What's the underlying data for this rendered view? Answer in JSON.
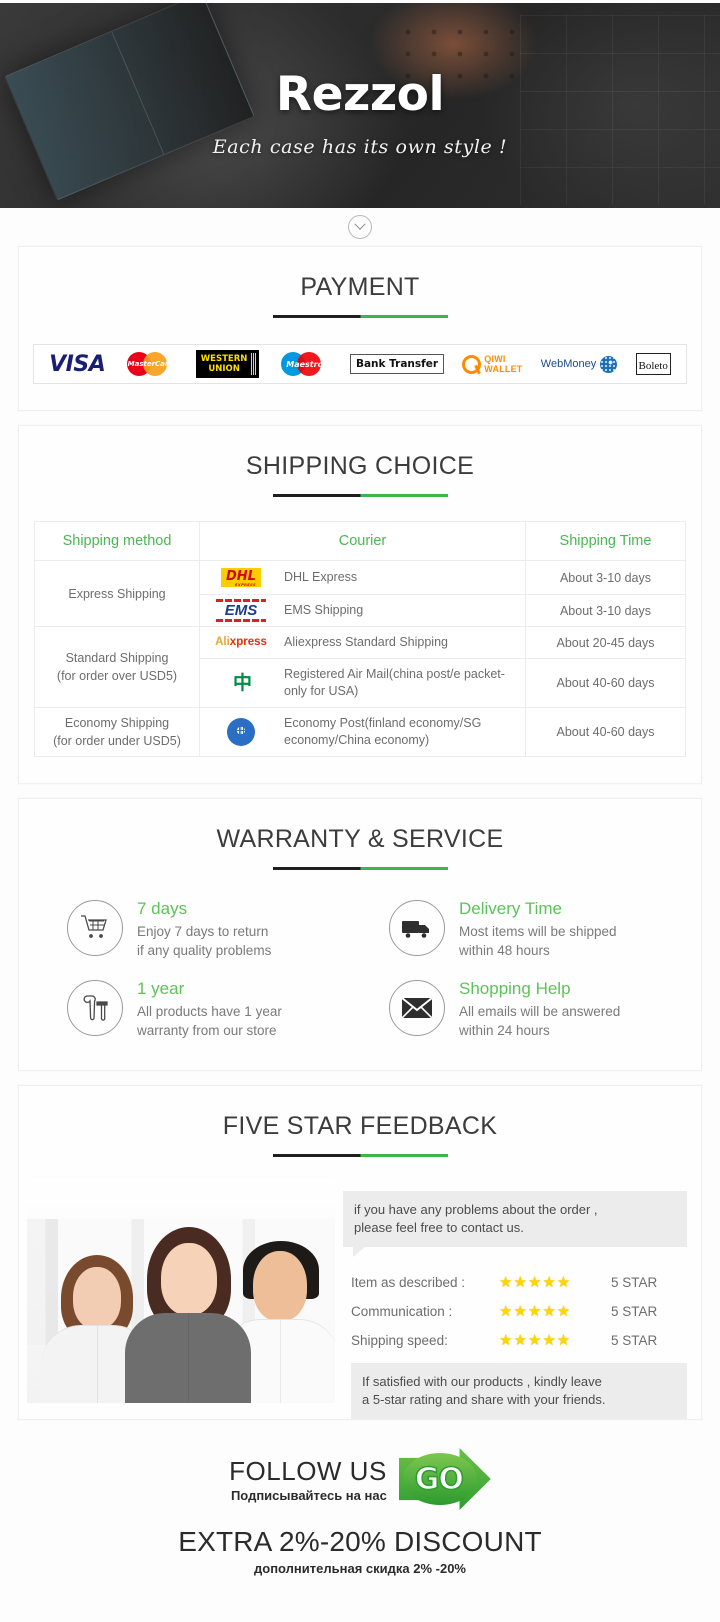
{
  "hero": {
    "brand": "Rezzol",
    "tagline": "Each case has its own style !"
  },
  "scroll_hint": {
    "icon": "chevron-down-icon"
  },
  "payment": {
    "title": "PAYMENT",
    "methods": [
      {
        "name": "VISA",
        "icon": "visa-logo"
      },
      {
        "name": "MasterCard",
        "icon": "mastercard-logo"
      },
      {
        "name": "WESTERN UNION",
        "line1": "WESTERN",
        "line2": "UNION",
        "icon": "western-union-logo"
      },
      {
        "name": "Maestro",
        "icon": "maestro-logo"
      },
      {
        "name": "Bank Transfer",
        "icon": "bank-transfer-logo"
      },
      {
        "name": "QIWI WALLET",
        "line1": "QIWI",
        "line2": "WALLET",
        "icon": "qiwi-wallet-logo"
      },
      {
        "name": "WebMoney",
        "icon": "webmoney-logo"
      },
      {
        "name": "Boleto",
        "icon": "boleto-logo"
      }
    ]
  },
  "shipping": {
    "title": "SHIPPING CHOICE",
    "headers": [
      "Shipping method",
      "Courier",
      "Shipping Time"
    ],
    "groups": [
      {
        "method": "Express Shipping",
        "method_line2": "",
        "rows": [
          {
            "logo": "dhl-logo",
            "logo_text": "DHL",
            "logo_sub": "EXPRESS",
            "courier": "DHL Express",
            "time": "About 3-10 days"
          },
          {
            "logo": "ems-logo",
            "logo_text": "EMS",
            "logo_sub": "",
            "courier": "EMS Shipping",
            "time": "About 3-10 days"
          }
        ]
      },
      {
        "method": "Standard Shipping",
        "method_line2": "(for order over USD5)",
        "rows": [
          {
            "logo": "aliexpress-logo",
            "logo_text": "Ali",
            "logo_sub": "xpress",
            "courier": "Aliexpress Standard Shipping",
            "time": "About 20-45 days"
          },
          {
            "logo": "china-post-logo",
            "logo_text": "",
            "logo_sub": "",
            "courier": "Registered Air Mail(china post/e packet-only for USA)",
            "time": "About 40-60 days"
          }
        ]
      },
      {
        "method": "Economy Shipping",
        "method_line2": "(for order under USD5)",
        "rows": [
          {
            "logo": "un-post-logo",
            "logo_text": "",
            "logo_sub": "",
            "courier": "Economy Post(finland economy/SG economy/China economy)",
            "time": "About 40-60 days"
          }
        ]
      }
    ]
  },
  "warranty": {
    "title": "WARRANTY & SERVICE",
    "items": [
      {
        "icon": "shopping-cart-icon",
        "heading": "7 days",
        "line1": "Enjoy 7 days to return",
        "line2": "if any quality problems"
      },
      {
        "icon": "delivery-truck-icon",
        "heading": "Delivery Time",
        "line1": "Most items will be shipped",
        "line2": "within 48 hours"
      },
      {
        "icon": "tools-icon",
        "heading": "1 year",
        "line1": "All products have 1 year",
        "line2": "warranty from our store"
      },
      {
        "icon": "envelope-icon",
        "heading": "Shopping Help",
        "line1": "All emails will be answered",
        "line2": "within 24 hours"
      }
    ]
  },
  "feedback": {
    "title": "FIVE STAR FEEDBACK",
    "bubble_top_line1": "if you have any problems about the order ,",
    "bubble_top_line2": "please feel free to contact us.",
    "ratings": [
      {
        "label": "Item as described :",
        "stars": "★★★★★",
        "value": "5 STAR"
      },
      {
        "label": "Communication :",
        "stars": "★★★★★",
        "value": "5 STAR"
      },
      {
        "label": "Shipping speed:",
        "stars": "★★★★★",
        "value": "5 STAR"
      }
    ],
    "bubble_bottom_line1": "If satisfied with our products , kindly leave",
    "bubble_bottom_line2": "a 5-star rating and share with your friends.",
    "photo_alt": "three smiling customer service representatives"
  },
  "footer": {
    "follow_en": "FOLLOW US",
    "follow_ru": "Подписывайтесь на нас",
    "go_label": "GO",
    "discount_en": "EXTRA 2%-20% DISCOUNT",
    "discount_ru": "дополнительная скидка 2% -20%"
  },
  "colors": {
    "green": "#3cb54a",
    "dark": "#1f1f1f",
    "text_gray": "#6d6d6d"
  }
}
